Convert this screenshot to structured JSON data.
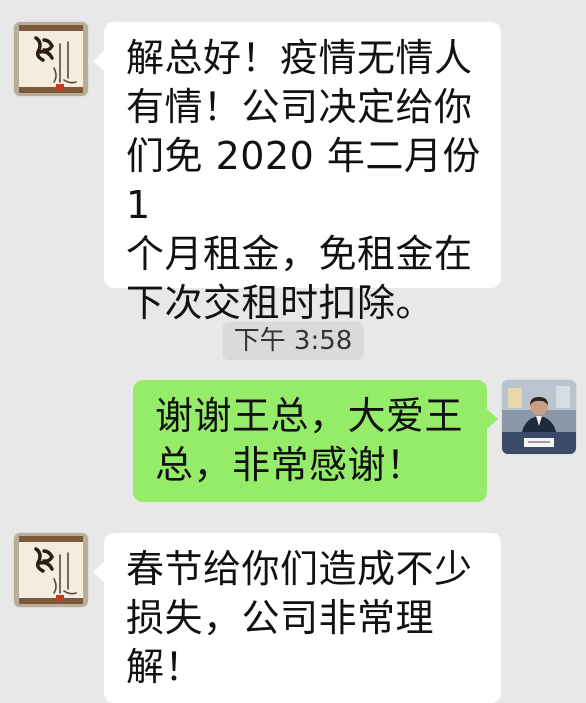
{
  "messages": {
    "incoming_1": {
      "lines": [
        "解总好！疫情无情人",
        "有情！公司决定给你",
        "们免 2020 年二月份 1",
        "个月租金，免租金在",
        "下次交租时扣除。"
      ]
    },
    "timestamp": "下午 3:58",
    "outgoing_1": {
      "lines": [
        "谢谢王总，大爱王",
        "总，非常感谢！"
      ]
    },
    "incoming_2": {
      "lines": [
        "春节给你们造成不少",
        "损失，公司非常理",
        "解！"
      ]
    }
  },
  "avatars": {
    "left_icon": "calligraphy-scroll-avatar",
    "right_icon": "person-photo-avatar"
  },
  "colors": {
    "background": "#e8e8e8",
    "incoming_bubble": "#ffffff",
    "outgoing_bubble": "#95ec69",
    "timestamp_pill": "#dadada"
  }
}
